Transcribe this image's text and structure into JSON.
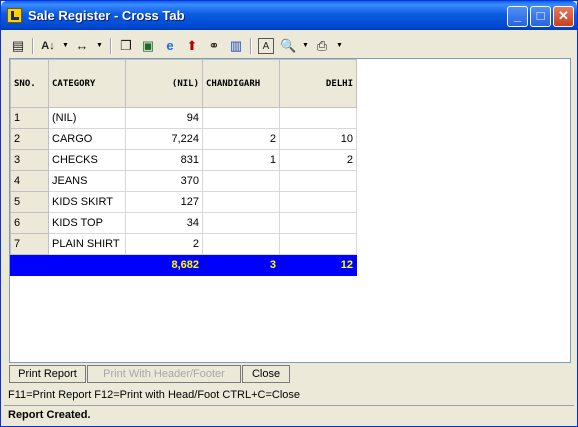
{
  "window": {
    "title": "Sale Register - Cross Tab"
  },
  "toolbar": {
    "icons": [
      "report-icon",
      "sort-az-icon",
      "column-width-icon",
      "copy-icon",
      "excel-icon",
      "internet-explorer-icon",
      "up-arrow-icon",
      "find-icon",
      "chart-icon",
      "font-icon",
      "print-preview-icon",
      "printer-icon"
    ]
  },
  "grid": {
    "headers": [
      "SNO.",
      "CATEGORY",
      "(NIL)",
      "CHANDIGARH",
      "DELHI"
    ],
    "rows": [
      [
        "1",
        "(NIL)",
        "94",
        "",
        ""
      ],
      [
        "2",
        "CARGO",
        "7,224",
        "2",
        "10"
      ],
      [
        "3",
        "CHECKS",
        "831",
        "1",
        "2"
      ],
      [
        "4",
        "JEANS",
        "370",
        "",
        ""
      ],
      [
        "5",
        "KIDS SKIRT",
        "127",
        "",
        ""
      ],
      [
        "6",
        "KIDS TOP",
        "34",
        "",
        ""
      ],
      [
        "7",
        "PLAIN SHIRT",
        "2",
        "",
        ""
      ]
    ],
    "total": [
      "",
      "",
      "8,682",
      "3",
      "12"
    ]
  },
  "buttons": {
    "print_report": "Print Report",
    "print_with_header": "Print With Header/Footer",
    "close": "Close"
  },
  "hint": "F11=Print Report  F12=Print with Head/Foot  CTRL+C=Close",
  "status": "Report Created.",
  "colors": {
    "total_row_bg": "#0000ff",
    "total_row_text": "#ffff00",
    "titlebar": "#0a5ce0"
  }
}
